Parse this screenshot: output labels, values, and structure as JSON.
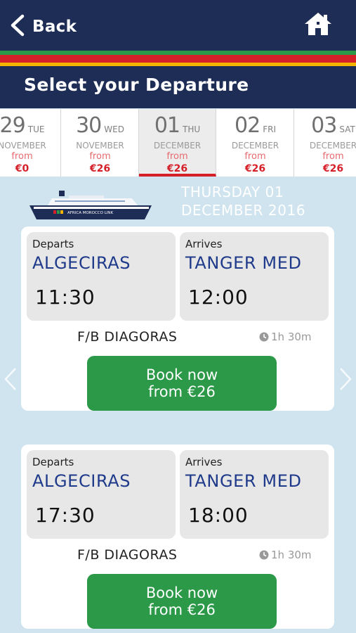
{
  "nav": {
    "back_label": "Back",
    "back_icon": "chevron-left-icon",
    "home_icon": "home-icon"
  },
  "colors": {
    "navy": "#1e2d55",
    "stripe_green": "#2b9948",
    "stripe_red": "#d5202a",
    "stripe_yellow": "#f4b400",
    "accent_red": "#d5202a",
    "book_green": "#2b9948",
    "port_blue": "#1f3a8a",
    "background": "#cfe4ef"
  },
  "page_title": "Select your Departure",
  "dates": [
    {
      "num": "29",
      "dow": "TUE",
      "month": "NOVEMBER",
      "from": "from",
      "price": "€0",
      "active": false
    },
    {
      "num": "30",
      "dow": "WED",
      "month": "NOVEMBER",
      "from": "from",
      "price": "€26",
      "active": false
    },
    {
      "num": "01",
      "dow": "THU",
      "month": "DECEMBER",
      "from": "from",
      "price": "€26",
      "active": true
    },
    {
      "num": "02",
      "dow": "FRI",
      "month": "DECEMBER",
      "from": "from",
      "price": "€26",
      "active": false
    },
    {
      "num": "03",
      "dow": "SAT",
      "month": "DECEMBER",
      "from": "from",
      "price": "€26",
      "active": false
    }
  ],
  "ship": {
    "brand": "AFRICA MOROCCO LINK",
    "icon": "ferry-ship-icon"
  },
  "day_heading": {
    "line1": "THURSDAY 01",
    "line2": "DECEMBER 2016"
  },
  "sailings": [
    {
      "departs_label": "Departs",
      "departs_port": "ALGECIRAS",
      "departs_time": "11:30",
      "arrives_label": "Arrives",
      "arrives_port": "TANGER MED",
      "arrives_time": "12:00",
      "vessel": "F/B DIAGORAS",
      "duration": "1h 30m",
      "book_line1": "Book now",
      "book_line2": "from €26"
    },
    {
      "departs_label": "Departs",
      "departs_port": "ALGECIRAS",
      "departs_time": "17:30",
      "arrives_label": "Arrives",
      "arrives_port": "TANGER MED",
      "arrives_time": "18:00",
      "vessel": "F/B DIAGORAS",
      "duration": "1h 30m",
      "book_line1": "Book now",
      "book_line2": "from €26"
    }
  ]
}
